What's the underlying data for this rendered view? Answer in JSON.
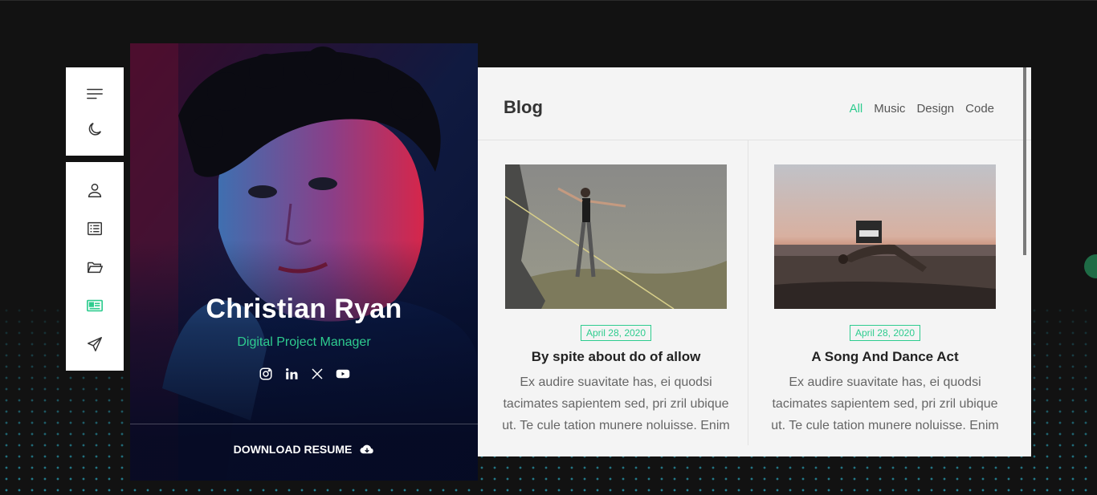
{
  "profile": {
    "name": "Christian Ryan",
    "role": "Digital Project Manager",
    "socials": [
      "instagram-icon",
      "linkedin-icon",
      "x-icon",
      "youtube-icon"
    ],
    "download_label": "DOWNLOAD RESUME"
  },
  "nav": {
    "top": [
      "menu-icon",
      "moon-icon"
    ],
    "main": [
      "user-icon",
      "resume-icon",
      "folder-icon",
      "blog-icon",
      "send-icon"
    ],
    "active": "blog-icon"
  },
  "blog": {
    "title": "Blog",
    "filters": [
      "All",
      "Music",
      "Design",
      "Code"
    ],
    "active_filter": "All",
    "posts": [
      {
        "date": "April 28, 2020",
        "title": "By spite about do of allow",
        "excerpt": "Ex audire suavitate has, ei quodsi tacimates sapientem sed, pri zril ubique ut. Te cule tation munere noluisse. Enim torquatos"
      },
      {
        "date": "April 28, 2020",
        "title": "A Song And Dance Act",
        "excerpt": "Ex audire suavitate has, ei quodsi tacimates sapientem sed, pri zril ubique ut. Te cule tation munere noluisse. Enim torquatos"
      }
    ]
  },
  "colors": {
    "accent": "#2ecc8f",
    "background": "#121212",
    "panel": "#f4f4f4"
  }
}
